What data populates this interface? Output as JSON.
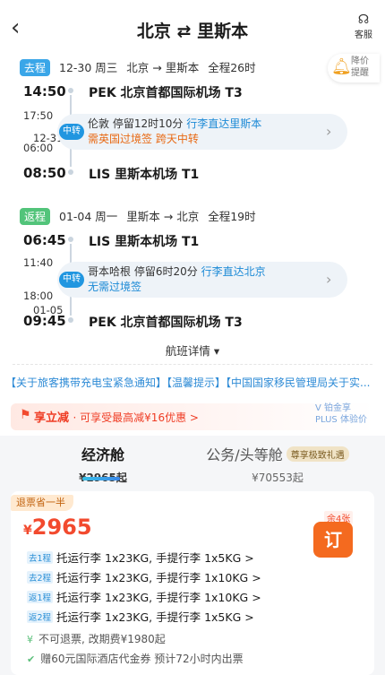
{
  "header": {
    "title": "北京 ⇄ 里斯本",
    "service": "客服"
  },
  "price_alert": {
    "line1": "降价",
    "line2": "提醒"
  },
  "outbound": {
    "tag": "去程",
    "date": "12-30 周三",
    "route": "北京 → 里斯本",
    "duration": "全程26时",
    "dep_time": "14:50",
    "dep_airport": "PEK 北京首都国际机场 T3",
    "transfer": {
      "badge": "中转",
      "arr_time": "17:50",
      "dep_date": "12-31",
      "dep_time": "06:00",
      "city": "伦敦",
      "stay": "停留12时10分",
      "baggage": "行李直达里斯本",
      "note1": "需英国过境签",
      "note2": "跨天中转"
    },
    "arr_time": "08:50",
    "arr_airport": "LIS 里斯本机场 T1"
  },
  "inbound": {
    "tag": "返程",
    "date": "01-04 周一",
    "route": "里斯本 → 北京",
    "duration": "全程19时",
    "dep_time": "06:45",
    "dep_airport": "LIS 里斯本机场 T1",
    "transfer": {
      "badge": "中转",
      "arr_time": "11:40",
      "dep_time": "18:00",
      "city": "哥本哈根",
      "stay": "停留6时20分",
      "baggage": "行李直达北京",
      "note1": "无需过境签"
    },
    "arr_date": "01-05",
    "arr_time": "09:45",
    "arr_airport": "PEK 北京首都国际机场 T3"
  },
  "details_link": "航班详情 ▾",
  "notice": "【关于旅客携带充电宝紧急通知】【温馨提示】【中国国家移民管理局关于实...",
  "promo": {
    "title": "享立减",
    "text": "· 可享受最高减¥16优惠 >",
    "plus_line1": "V 铂金享",
    "plus_line2": "PLUS 体验价"
  },
  "cabins": [
    {
      "name": "经济舱",
      "price": "¥2965起"
    },
    {
      "name": "公务/头等舱",
      "price": "¥70553起",
      "badge": "尊享极致礼遇"
    }
  ],
  "offer": {
    "badge": "退票省一半",
    "currency": "¥",
    "price": "2965",
    "remaining": "余4张",
    "book": "订",
    "bags": [
      {
        "leg": "去1程",
        "text": "托运行李 1x23KG, 手提行李 1x5KG >"
      },
      {
        "leg": "去2程",
        "text": "托运行李 1x23KG, 手提行李 1x10KG >"
      },
      {
        "leg": "返1程",
        "text": "托运行李 1x23KG, 手提行李 1x10KG >"
      },
      {
        "leg": "返2程",
        "text": "托运行李 1x23KG, 手提行李 1x5KG >"
      }
    ],
    "policy1": "不可退票, 改期费¥1980起",
    "policy2": "赠60元国际酒店代金券 预计72小时内出票"
  },
  "colors": {
    "accent": "#2196e0",
    "price": "#f24a2e",
    "book": "#f46a1f"
  }
}
